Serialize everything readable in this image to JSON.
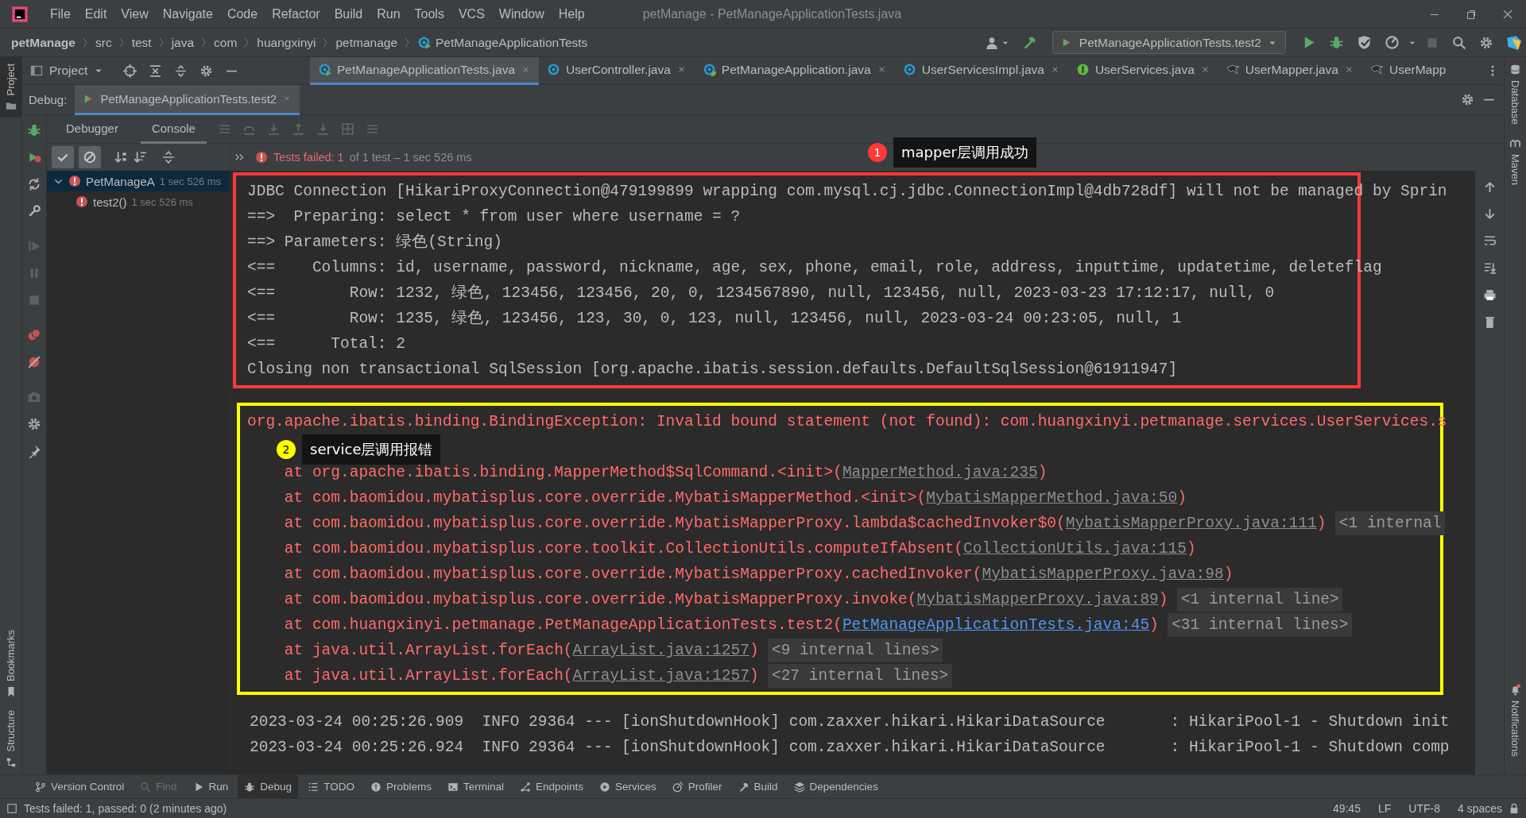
{
  "menu_bar": {
    "items": [
      "File",
      "Edit",
      "View",
      "Navigate",
      "Code",
      "Refactor",
      "Build",
      "Run",
      "Tools",
      "VCS",
      "Window",
      "Help"
    ],
    "title": "petManage - PetManageApplicationTests.java"
  },
  "navigation_bar": {
    "breadcrumbs": [
      "petManage",
      "src",
      "test",
      "java",
      "com",
      "huangxinyi",
      "petmanage",
      "PetManageApplicationTests"
    ],
    "run_configuration": "PetManageApplicationTests.test2"
  },
  "project_tool": {
    "label": "Project"
  },
  "editor_tabs": [
    {
      "label": "PetManageApplicationTests.java",
      "kind": "test-class",
      "selected": true,
      "closable": true
    },
    {
      "label": "UserController.java",
      "kind": "class",
      "selected": false,
      "closable": true
    },
    {
      "label": "PetManageApplication.java",
      "kind": "spring-class",
      "selected": false,
      "closable": true
    },
    {
      "label": "UserServicesImpl.java",
      "kind": "class",
      "selected": false,
      "closable": true
    },
    {
      "label": "UserServices.java",
      "kind": "interface",
      "selected": false,
      "closable": true
    },
    {
      "label": "UserMapper.java",
      "kind": "mapper",
      "selected": false,
      "closable": true
    },
    {
      "label": "UserMapp",
      "kind": "mapper",
      "selected": false,
      "closable": false
    }
  ],
  "left_stripe": [
    {
      "label": "Project",
      "selected": true
    },
    {
      "label": "Bookmarks",
      "selected": false
    },
    {
      "label": "Structure",
      "selected": false
    }
  ],
  "right_stripe": [
    {
      "label": "Database",
      "kind": "database"
    },
    {
      "label": "Maven",
      "kind": "maven"
    },
    {
      "label": "Notifications",
      "kind": "notifications"
    }
  ],
  "debug": {
    "label": "Debug:",
    "session_tab": "PetManageApplicationTests.test2",
    "tabs": [
      {
        "label": "Debugger",
        "selected": false
      },
      {
        "label": "Console",
        "selected": true
      }
    ],
    "show_passed": true,
    "show_ignored": true,
    "test_status": {
      "failed": "Tests failed: 1",
      "summary": "of 1 test – 1 sec 526 ms"
    },
    "test_tree": [
      {
        "name": "PetManageA",
        "time": "1 sec 526 ms",
        "expanded": true,
        "selected": true,
        "children": [
          {
            "name": "test2()",
            "time": "1 sec 526 ms",
            "selected": false
          }
        ]
      }
    ]
  },
  "console": {
    "blocks": [
      {
        "annotation": {
          "number": "1",
          "text": "mapper层调用成功",
          "color": "#ff3838"
        },
        "lines": [
          {
            "kind": "log",
            "text": "JDBC Connection [HikariProxyConnection@479199899 wrapping com.mysql.cj.jdbc.ConnectionImpl@4db728df] will not be managed by Sprin"
          },
          {
            "kind": "log",
            "text": "==>  Preparing: select * from user where username = ?"
          },
          {
            "kind": "log",
            "text": "==> Parameters: 绿色(String)"
          },
          {
            "kind": "log",
            "text": "<==    Columns: id, username, password, nickname, age, sex, phone, email, role, address, inputtime, updatetime, deleteflag"
          },
          {
            "kind": "log",
            "text": "<==        Row: 1232, 绿色, 123456, 123456, 20, 0, 1234567890, null, 123456, null, 2023-03-23 17:12:17, null, 0"
          },
          {
            "kind": "log",
            "text": "<==        Row: 1235, 绿色, 123456, 123, 30, 0, 123, null, 123456, null, 2023-03-24 00:23:05, null, 1"
          },
          {
            "kind": "log",
            "text": "<==      Total: 2"
          },
          {
            "kind": "log",
            "text": "Closing non transactional SqlSession [org.apache.ibatis.session.defaults.DefaultSqlSession@61911947]"
          }
        ]
      },
      {
        "annotation": {
          "number": "2",
          "text": "service层调用报错",
          "color": "#ffff00"
        },
        "lines": [
          {
            "kind": "error",
            "text": "org.apache.ibatis.binding.BindingException: Invalid bound statement (not found): com.huangxinyi.petmanage.services.UserServices.s"
          },
          {
            "kind": "blank"
          },
          {
            "kind": "frame",
            "text": "at org.apache.ibatis.binding.MapperMethod$SqlCommand.<init>(",
            "link": "MapperMethod.java:235",
            "close": ")",
            "project": false
          },
          {
            "kind": "frame",
            "text": "at com.baomidou.mybatisplus.core.override.MybatisMapperMethod.<init>(",
            "link": "MybatisMapperMethod.java:50",
            "close": ")",
            "project": false
          },
          {
            "kind": "frame",
            "text": "at com.baomidou.mybatisplus.core.override.MybatisMapperProxy.lambda$cachedInvoker$0(",
            "link": "MybatisMapperProxy.java:111",
            "close": ")",
            "project": false,
            "internal": "<1 internal"
          },
          {
            "kind": "frame",
            "text": "at com.baomidou.mybatisplus.core.toolkit.CollectionUtils.computeIfAbsent(",
            "link": "CollectionUtils.java:115",
            "close": ")",
            "project": false
          },
          {
            "kind": "frame",
            "text": "at com.baomidou.mybatisplus.core.override.MybatisMapperProxy.cachedInvoker(",
            "link": "MybatisMapperProxy.java:98",
            "close": ")",
            "project": false
          },
          {
            "kind": "frame",
            "text": "at com.baomidou.mybatisplus.core.override.MybatisMapperProxy.invoke(",
            "link": "MybatisMapperProxy.java:89",
            "close": ")",
            "project": false,
            "internal": "<1 internal line>"
          },
          {
            "kind": "frame",
            "text": "at com.huangxinyi.petmanage.PetManageApplicationTests.test2(",
            "link": "PetManageApplicationTests.java:45",
            "close": ")",
            "project": true,
            "internal": "<31 internal lines>"
          },
          {
            "kind": "frame",
            "text": "at java.util.ArrayList.forEach(",
            "link": "ArrayList.java:1257",
            "close": ")",
            "project": false,
            "internal": "<9 internal lines>"
          },
          {
            "kind": "frame",
            "text": "at java.util.ArrayList.forEach(",
            "link": "ArrayList.java:1257",
            "close": ")",
            "project": false,
            "internal": "<27 internal lines>"
          }
        ]
      },
      {
        "lines": [
          {
            "kind": "log",
            "text": "2023-03-24 00:25:26.909  INFO 29364 --- [ionShutdownHook] com.zaxxer.hikari.HikariDataSource       : HikariPool-1 - Shutdown init"
          },
          {
            "kind": "log",
            "text": "2023-03-24 00:25:26.924  INFO 29364 --- [ionShutdownHook] com.zaxxer.hikari.HikariDataSource       : HikariPool-1 - Shutdown comp"
          }
        ]
      }
    ]
  },
  "bottom_tools": [
    {
      "label": "Version Control",
      "kind": "vcs",
      "selected": false,
      "disabled": false
    },
    {
      "label": "Find",
      "kind": "find",
      "selected": false,
      "disabled": true
    },
    {
      "label": "Run",
      "kind": "run",
      "selected": false,
      "disabled": false
    },
    {
      "label": "Debug",
      "kind": "debug",
      "selected": true,
      "disabled": false
    },
    {
      "label": "TODO",
      "kind": "todo",
      "selected": false,
      "disabled": false
    },
    {
      "label": "Problems",
      "kind": "problems",
      "selected": false,
      "disabled": false
    },
    {
      "label": "Terminal",
      "kind": "terminal",
      "selected": false,
      "disabled": false
    },
    {
      "label": "Endpoints",
      "kind": "endpoints",
      "selected": false,
      "disabled": false
    },
    {
      "label": "Services",
      "kind": "services",
      "selected": false,
      "disabled": false
    },
    {
      "label": "Profiler",
      "kind": "profiler",
      "selected": false,
      "disabled": false
    },
    {
      "label": "Build",
      "kind": "build",
      "selected": false,
      "disabled": false
    },
    {
      "label": "Dependencies",
      "kind": "dependencies",
      "selected": false,
      "disabled": false
    }
  ],
  "status_bar": {
    "message": "Tests failed: 1, passed: 0 (2 minutes ago)",
    "position": "49:45",
    "line_separator": "LF",
    "encoding": "UTF-8",
    "indent": "4 spaces"
  }
}
